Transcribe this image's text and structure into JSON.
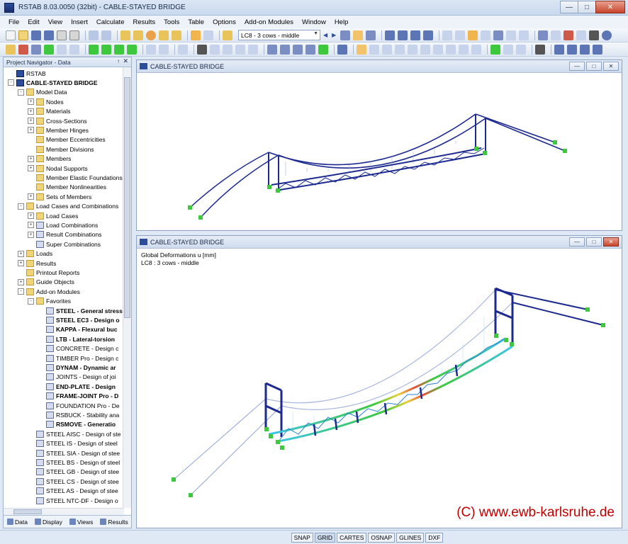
{
  "app": {
    "title": "RSTAB 8.03.0050 (32bit) - CABLE-STAYED BRIDGE",
    "window_buttons": [
      "—",
      "□",
      "✕"
    ]
  },
  "menu": [
    "File",
    "Edit",
    "View",
    "Insert",
    "Calculate",
    "Results",
    "Tools",
    "Table",
    "Options",
    "Add-on Modules",
    "Window",
    "Help"
  ],
  "toolbar": {
    "loadcase": "LC8 - 3 cows - middle",
    "nav_arrows": [
      "◀",
      "▶"
    ]
  },
  "navigator": {
    "title": "Project Navigator - Data",
    "pin": "↑",
    "close": "✕",
    "items": [
      {
        "label": "RSTAB",
        "bold": false,
        "level": 0,
        "icon": "root",
        "exp": ""
      },
      {
        "label": "CABLE-STAYED BRIDGE",
        "bold": true,
        "level": 0,
        "icon": "root",
        "exp": "-"
      },
      {
        "label": "Model Data",
        "bold": false,
        "level": 1,
        "icon": "folder",
        "exp": "-"
      },
      {
        "label": "Nodes",
        "bold": false,
        "level": 2,
        "icon": "folder",
        "exp": "+"
      },
      {
        "label": "Materials",
        "bold": false,
        "level": 2,
        "icon": "folder",
        "exp": "+"
      },
      {
        "label": "Cross-Sections",
        "bold": false,
        "level": 2,
        "icon": "folder",
        "exp": "+"
      },
      {
        "label": "Member Hinges",
        "bold": false,
        "level": 2,
        "icon": "folder",
        "exp": "+"
      },
      {
        "label": "Member Eccentricities",
        "bold": false,
        "level": 2,
        "icon": "folder",
        "exp": ""
      },
      {
        "label": "Member Divisions",
        "bold": false,
        "level": 2,
        "icon": "folder",
        "exp": ""
      },
      {
        "label": "Members",
        "bold": false,
        "level": 2,
        "icon": "folder",
        "exp": "+"
      },
      {
        "label": "Nodal Supports",
        "bold": false,
        "level": 2,
        "icon": "folder",
        "exp": "+"
      },
      {
        "label": "Member Elastic Foundations",
        "bold": false,
        "level": 2,
        "icon": "folder",
        "exp": ""
      },
      {
        "label": "Member Nonlinearities",
        "bold": false,
        "level": 2,
        "icon": "folder",
        "exp": ""
      },
      {
        "label": "Sets of Members",
        "bold": false,
        "level": 2,
        "icon": "folder",
        "exp": "+"
      },
      {
        "label": "Load Cases and Combinations",
        "bold": false,
        "level": 1,
        "icon": "folder",
        "exp": "-"
      },
      {
        "label": "Load Cases",
        "bold": false,
        "level": 2,
        "icon": "folder",
        "exp": "+"
      },
      {
        "label": "Load Combinations",
        "bold": false,
        "level": 2,
        "icon": "module",
        "exp": "+"
      },
      {
        "label": "Result Combinations",
        "bold": false,
        "level": 2,
        "icon": "module",
        "exp": "+"
      },
      {
        "label": "Super Combinations",
        "bold": false,
        "level": 2,
        "icon": "module",
        "exp": ""
      },
      {
        "label": "Loads",
        "bold": false,
        "level": 1,
        "icon": "folder",
        "exp": "+"
      },
      {
        "label": "Results",
        "bold": false,
        "level": 1,
        "icon": "folder",
        "exp": "+"
      },
      {
        "label": "Printout Reports",
        "bold": false,
        "level": 1,
        "icon": "folder",
        "exp": ""
      },
      {
        "label": "Guide Objects",
        "bold": false,
        "level": 1,
        "icon": "folder",
        "exp": "+"
      },
      {
        "label": "Add-on Modules",
        "bold": false,
        "level": 1,
        "icon": "folder",
        "exp": "-"
      },
      {
        "label": "Favorites",
        "bold": false,
        "level": 2,
        "icon": "folder",
        "exp": "-"
      },
      {
        "label": "STEEL - General stress",
        "bold": true,
        "level": 3,
        "icon": "module",
        "exp": ""
      },
      {
        "label": "STEEL EC3 - Design o",
        "bold": true,
        "level": 3,
        "icon": "module",
        "exp": ""
      },
      {
        "label": "KAPPA - Flexural buc",
        "bold": true,
        "level": 3,
        "icon": "module",
        "exp": ""
      },
      {
        "label": "LTB - Lateral-torsion",
        "bold": true,
        "level": 3,
        "icon": "module",
        "exp": ""
      },
      {
        "label": "CONCRETE - Design c",
        "bold": false,
        "level": 3,
        "icon": "module",
        "exp": ""
      },
      {
        "label": "TIMBER Pro - Design c",
        "bold": false,
        "level": 3,
        "icon": "module",
        "exp": ""
      },
      {
        "label": "DYNAM - Dynamic ar",
        "bold": true,
        "level": 3,
        "icon": "module",
        "exp": ""
      },
      {
        "label": "JOINTS - Design of joi",
        "bold": false,
        "level": 3,
        "icon": "module",
        "exp": ""
      },
      {
        "label": "END-PLATE - Design",
        "bold": true,
        "level": 3,
        "icon": "module",
        "exp": ""
      },
      {
        "label": "FRAME-JOINT Pro - D",
        "bold": true,
        "level": 3,
        "icon": "module",
        "exp": ""
      },
      {
        "label": "FOUNDATION Pro - De",
        "bold": false,
        "level": 3,
        "icon": "module",
        "exp": ""
      },
      {
        "label": "RSBUCK - Stability ana",
        "bold": false,
        "level": 3,
        "icon": "module",
        "exp": ""
      },
      {
        "label": "RSMOVE - Generatio",
        "bold": true,
        "level": 3,
        "icon": "module",
        "exp": ""
      },
      {
        "label": "STEEL AISC - Design of ste",
        "bold": false,
        "level": 2,
        "icon": "module",
        "exp": ""
      },
      {
        "label": "STEEL IS - Design of steel",
        "bold": false,
        "level": 2,
        "icon": "module",
        "exp": ""
      },
      {
        "label": "STEEL SIA - Design of stee",
        "bold": false,
        "level": 2,
        "icon": "module",
        "exp": ""
      },
      {
        "label": "STEEL BS - Design of steel",
        "bold": false,
        "level": 2,
        "icon": "module",
        "exp": ""
      },
      {
        "label": "STEEL GB - Design of stee",
        "bold": false,
        "level": 2,
        "icon": "module",
        "exp": ""
      },
      {
        "label": "STEEL CS - Design of stee",
        "bold": false,
        "level": 2,
        "icon": "module",
        "exp": ""
      },
      {
        "label": "STEEL AS - Design of stee",
        "bold": false,
        "level": 2,
        "icon": "module",
        "exp": ""
      },
      {
        "label": "STEEL NTC-DF - Design o",
        "bold": false,
        "level": 2,
        "icon": "module",
        "exp": ""
      }
    ],
    "tabs": [
      "Data",
      "Display",
      "Views",
      "Results"
    ]
  },
  "windows": {
    "top": {
      "title": "CABLE-STAYED BRIDGE"
    },
    "bottom": {
      "title": "CABLE-STAYED BRIDGE",
      "info_line1": "Global Deformations u [mm]",
      "info_line2": "LC8 : 3 cows - middle",
      "copyright": "(C) www.ewb-karlsruhe.de"
    },
    "buttons": [
      "—",
      "□",
      "✕"
    ]
  },
  "statusbar": [
    "SNAP",
    "GRID",
    "CARTES",
    "OSNAP",
    "GLINES",
    "DXF"
  ],
  "colors": {
    "member_blue": "#1c2a8f",
    "support_green": "#3ec83e",
    "cable_blue": "#8fa3d8"
  }
}
